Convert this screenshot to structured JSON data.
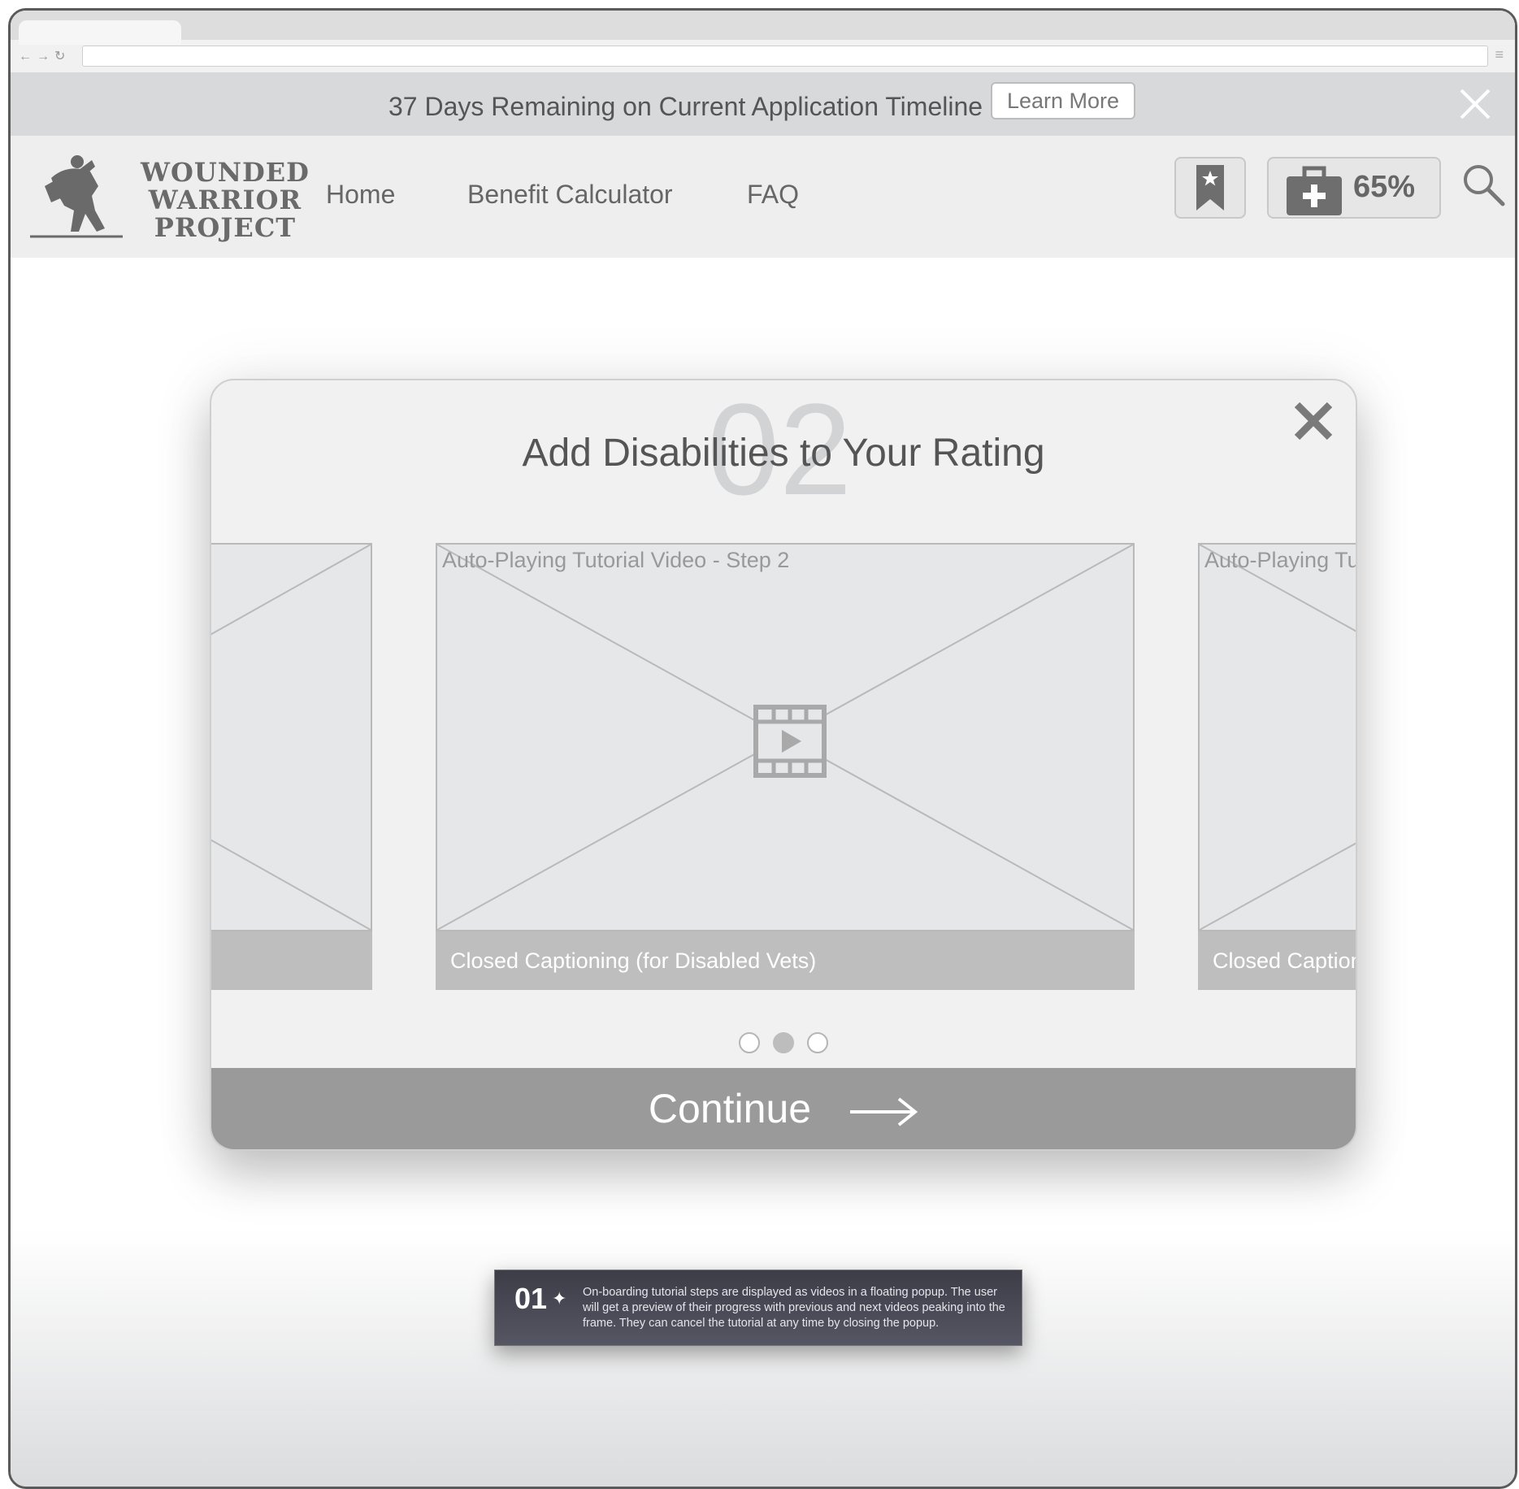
{
  "banner": {
    "message": "37 Days Remaining on Current Application Timeline",
    "learn_more": "Learn More"
  },
  "header": {
    "logo_lines": [
      "WOUNDED",
      "WARRIOR",
      "PROJECT"
    ],
    "nav": [
      "Home",
      "Benefit Calculator",
      "FAQ"
    ],
    "progress_percent": "65%"
  },
  "popup": {
    "step_number": "02",
    "title": "Add Disabilities to Your Rating",
    "slides": [
      {
        "label": "",
        "caption": ""
      },
      {
        "label": "Auto-Playing Tutorial Video - Step 2",
        "caption": "Closed Captioning (for Disabled Vets)"
      },
      {
        "label": "Auto-Playing Tut",
        "caption": "Closed Caption"
      }
    ],
    "active_dot": 1,
    "dot_count": 3,
    "continue_label": "Continue"
  },
  "annotation": {
    "number": "01",
    "text": "On-boarding tutorial steps are displayed as videos in a floating popup. The user will get a preview of their progress with previous and next videos peaking into the frame. They can cancel the tutorial at any time by closing the popup."
  },
  "colors": {
    "banner_bg": "#d8d9db",
    "header_bg": "#eeeeee",
    "continue_bg": "#9a9a9a",
    "caption_bg": "#bebebf"
  }
}
